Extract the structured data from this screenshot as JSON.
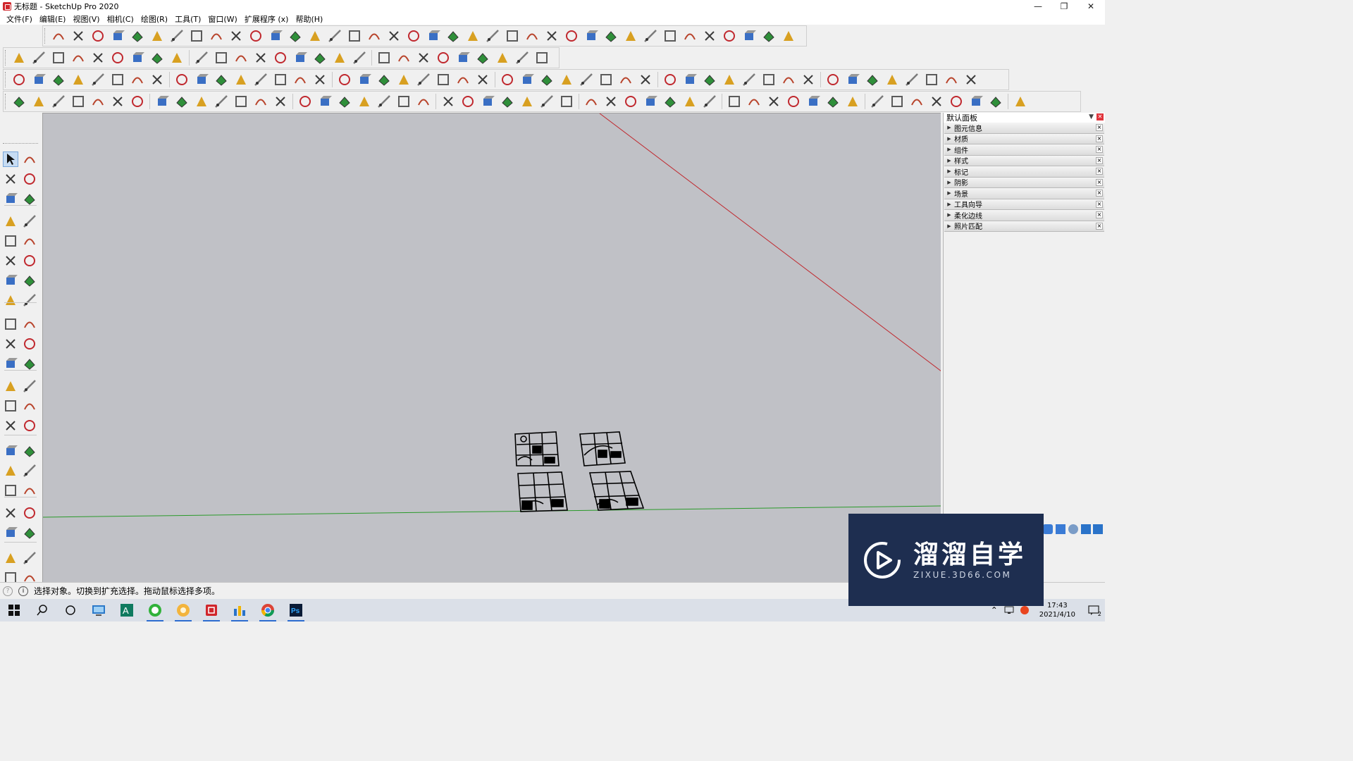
{
  "window": {
    "title": "无标题 - SketchUp Pro 2020",
    "controls": [
      "minimize-icon",
      "restore-icon",
      "close-icon"
    ]
  },
  "menu": [
    "文件(F)",
    "编辑(E)",
    "视图(V)",
    "相机(C)",
    "绘图(R)",
    "工具(T)",
    "窗口(W)",
    "扩展程序 (x)",
    "帮助(H)"
  ],
  "tray": {
    "title": "默认面板",
    "panels": [
      "图元信息",
      "材质",
      "组件",
      "样式",
      "标记",
      "阴影",
      "场景",
      "工具向导",
      "柔化边线",
      "照片匹配"
    ]
  },
  "status": {
    "message": "选择对象。切换到扩充选择。拖动鼠标选择多项。"
  },
  "taskbar": {
    "time": "17:43",
    "date": "2021/4/10",
    "notification_count": "2",
    "apps": [
      "file-explorer-icon",
      "access-icon",
      "wechat-icon",
      "app-icon",
      "sketchup-icon",
      "chart-app-icon",
      "chrome-icon",
      "photoshop-icon"
    ]
  },
  "watermark": {
    "title": "溜溜自学",
    "subtitle": "ZIXUE.3D66.COM"
  },
  "colors": {
    "viewport_bg": "#c0c1c6",
    "red_axis": "#c0282e",
    "green_axis": "#2a9a2a",
    "watermark_bg": "#1e2e50",
    "accent_red": "#d0262c"
  }
}
